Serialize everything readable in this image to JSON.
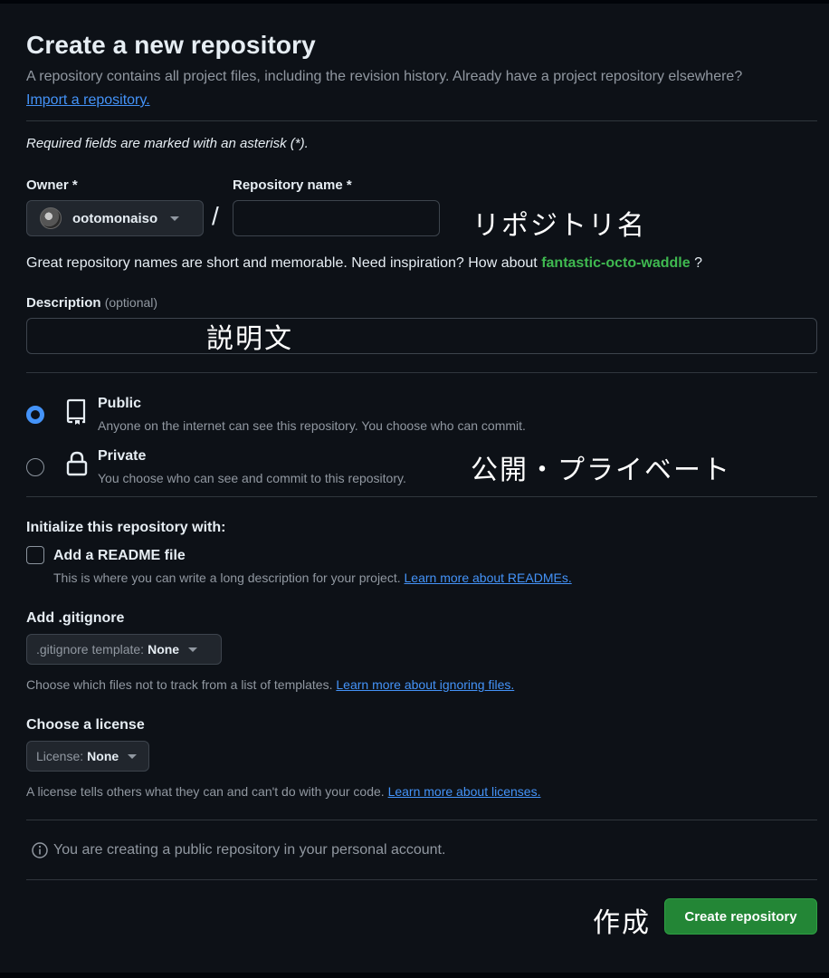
{
  "header": {
    "title": "Create a new repository",
    "subtitle": "A repository contains all project files, including the revision history. Already have a project repository elsewhere?",
    "import_link": "Import a repository."
  },
  "form": {
    "required_note": "Required fields are marked with an asterisk (*).",
    "owner_label": "Owner *",
    "owner_name": "ootomonaiso",
    "slash": "/",
    "repo_label": "Repository name *",
    "repo_value": "",
    "hint_prefix": "Great repository names are short and memorable. Need inspiration? How about",
    "hint_suggestion": "fantastic-octo-waddle",
    "hint_suffix": "?",
    "description_label": "Description",
    "description_optional": "(optional)",
    "description_value": ""
  },
  "visibility": {
    "options": [
      {
        "title": "Public",
        "desc": "Anyone on the internet can see this repository. You choose who can commit.",
        "selected": true,
        "icon": "repo-icon"
      },
      {
        "title": "Private",
        "desc": "You choose who can see and commit to this repository.",
        "selected": false,
        "icon": "lock-icon"
      }
    ]
  },
  "initialize": {
    "label": "Initialize this repository with:",
    "readme_label": "Add a README file",
    "readme_checked": false,
    "readme_desc": "This is where you can write a long description for your project.",
    "readme_link": "Learn more about READMEs."
  },
  "gitignore": {
    "label": "Add .gitignore",
    "select_prefix": ".gitignore template:",
    "select_value": "None",
    "desc": "Choose which files not to track from a list of templates.",
    "link": "Learn more about ignoring files."
  },
  "license": {
    "label": "Choose a license",
    "select_prefix": "License:",
    "select_value": "None",
    "desc": "A license tells others what they can and can't do with your code.",
    "link": "Learn more about licenses."
  },
  "info": {
    "text": "You are creating a public repository in your personal account.",
    "icon": "info-icon"
  },
  "submit": {
    "label": "Create repository"
  },
  "annotations": {
    "repo_name": "リポジトリ名",
    "description": "説明文",
    "visibility": "公開・プライベート",
    "create": "作成"
  },
  "colors": {
    "background": "#0d1117",
    "accent_link": "#4493f8",
    "suggestion": "#3fb950",
    "primary_button": "#238636"
  }
}
